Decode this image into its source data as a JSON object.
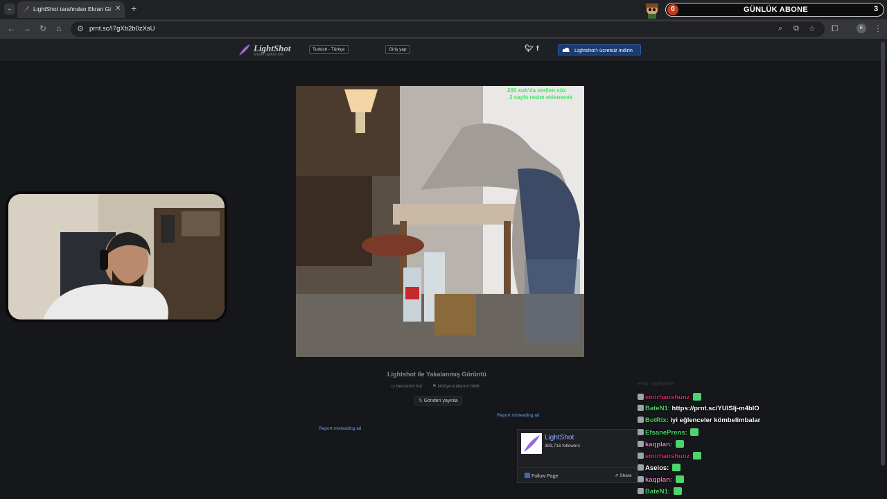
{
  "browser": {
    "tab_title": "LightShot tarafından Ekran Görü",
    "url": "prnt.sc/I7gXb2b0zXsU",
    "avatar_letter": "E"
  },
  "overlay": {
    "counter_title": "GÜNLÜK ABONE",
    "counter_left": "0",
    "counter_right": "3"
  },
  "site": {
    "logo_text": "LightShot",
    "logo_sub": "screen capture tool",
    "language": "Turkish - Türkçe",
    "login": "Giriş yap",
    "twitter": "t",
    "facebook": "f",
    "download": "Lightshot'ı ücretsiz indirin",
    "caption": "Lightshot ile Yakalanmış Görüntü",
    "find_similar": "benzerini bul",
    "report_abuse": "kötüye kullanım bildir",
    "tweet": "Gönderi yayınla",
    "report_ad_1": "Report misleading ad",
    "report_ad_2": "Report misleading ad",
    "screenshot_overlay_text_1": "200 sub'da verilen söz",
    "screenshot_overlay_text_2": "2 sayfa resim eklenecek"
  },
  "fb_widget": {
    "name": "LightShot",
    "followers": "383,716 followers",
    "follow": "Follow Page",
    "share": "Share"
  },
  "chat": {
    "faded": "ersu sayfamne",
    "lines": [
      {
        "user": "emirhanshunz",
        "color": "#e0245e",
        "msg": ""
      },
      {
        "user": "BateN1:",
        "color": "#4fd46b",
        "msg": "https://prnt.sc/YUISIj-m4bIO"
      },
      {
        "user": "BotRix:",
        "color": "#4fd46b",
        "msg": "iyi eğlenceler kömbelimbalar"
      },
      {
        "user": "EfsanePrens:",
        "color": "#4fd46b",
        "msg": ""
      },
      {
        "user": "kaqplan:",
        "color": "#e67ac0",
        "msg": ""
      },
      {
        "user": "emirhanshunz",
        "color": "#e0245e",
        "msg": ""
      },
      {
        "user": "Aselos:",
        "color": "#ffffff",
        "msg": ""
      },
      {
        "user": "kaqplan:",
        "color": "#e67ac0",
        "msg": ""
      },
      {
        "user": "BateN1:",
        "color": "#4fd46b",
        "msg": ""
      }
    ]
  }
}
